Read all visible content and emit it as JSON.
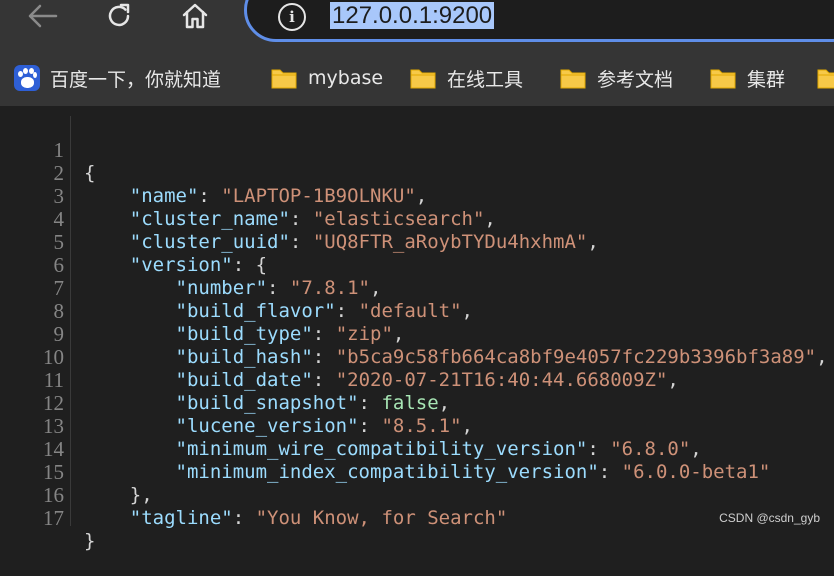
{
  "browser": {
    "url_text": "127.0.0.1:9200"
  },
  "bookmarks": [
    {
      "label": "百度一下，你就知道",
      "icon": "baidu-icon"
    },
    {
      "label": "mybase",
      "icon": "folder-icon"
    },
    {
      "label": "在线工具",
      "icon": "folder-icon"
    },
    {
      "label": "参考文档",
      "icon": "folder-icon"
    },
    {
      "label": "集群",
      "icon": "folder-icon"
    }
  ],
  "json_view": {
    "line_numbers": [
      "1",
      "2",
      "3",
      "4",
      "5",
      "6",
      "7",
      "8",
      "9",
      "10",
      "11",
      "12",
      "13",
      "14",
      "15",
      "16",
      "17"
    ],
    "name_key": "\"name\"",
    "name_value": "\"LAPTOP-1B9OLNKU\"",
    "cluster_name_key": "\"cluster_name\"",
    "cluster_name_value": "\"elasticsearch\"",
    "cluster_uuid_key": "\"cluster_uuid\"",
    "cluster_uuid_value": "\"UQ8FTR_aRoybTYDu4hxhmA\"",
    "version_key": "\"version\"",
    "number_key": "\"number\"",
    "number_value": "\"7.8.1\"",
    "build_flavor_key": "\"build_flavor\"",
    "build_flavor_value": "\"default\"",
    "build_type_key": "\"build_type\"",
    "build_type_value": "\"zip\"",
    "build_hash_key": "\"build_hash\"",
    "build_hash_value": "\"b5ca9c58fb664ca8bf9e4057fc229b3396bf3a89\"",
    "build_date_key": "\"build_date\"",
    "build_date_value": "\"2020-07-21T16:40:44.668009Z\"",
    "build_snapshot_key": "\"build_snapshot\"",
    "build_snapshot_value": "false",
    "lucene_version_key": "\"lucene_version\"",
    "lucene_version_value": "\"8.5.1\"",
    "min_wire_key": "\"minimum_wire_compatibility_version\"",
    "min_wire_value": "\"6.8.0\"",
    "min_index_key": "\"minimum_index_compatibility_version\"",
    "min_index_value": "\"6.0.0-beta1\"",
    "tagline_key": "\"tagline\"",
    "tagline_value": "\"You Know, for Search\"",
    "open_brace": "{",
    "close_brace": "}",
    "version_open": ": {",
    "version_close": "},",
    "colon": ": ",
    "comma": ","
  },
  "watermark": "CSDN @csdn_gyb",
  "colors": {
    "key": "#9cdcfe",
    "string": "#ce9178",
    "boolean": "#a8e6b5",
    "address_border": "#5f8ee8",
    "url_highlight": "#a8c7fa"
  }
}
